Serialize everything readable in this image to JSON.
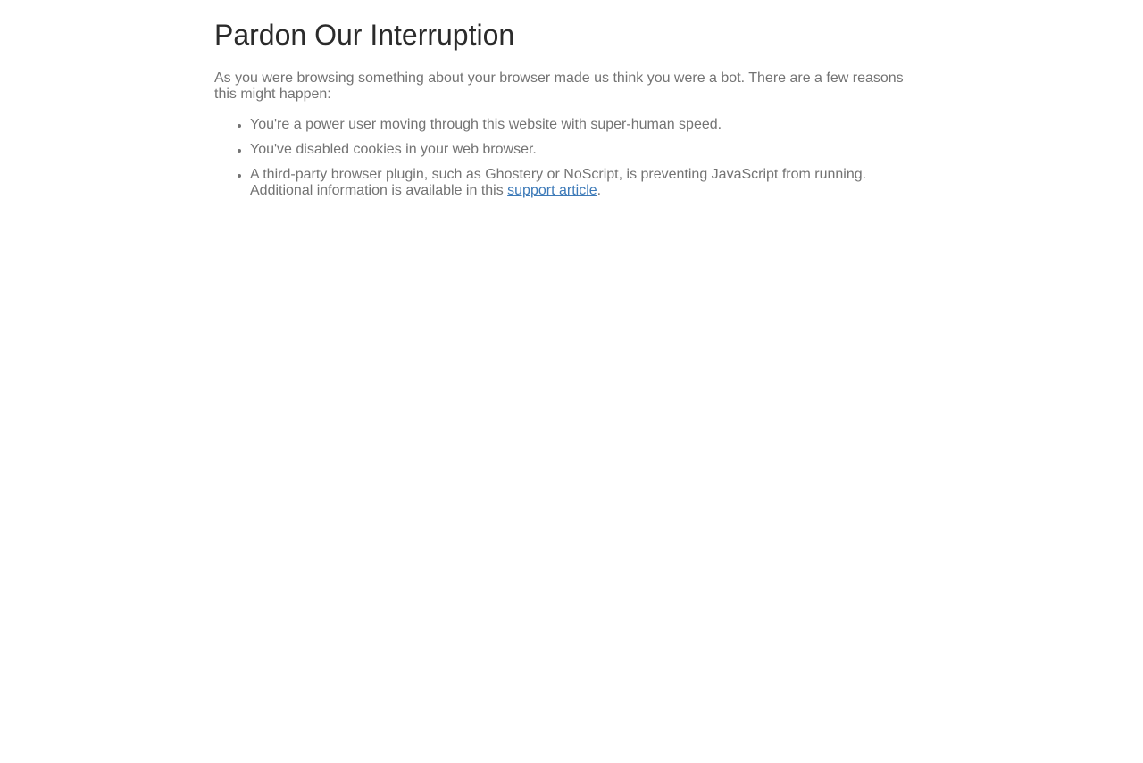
{
  "page": {
    "title": "Pardon Our Interruption",
    "intro": "As you were browsing something about your browser made us think you were a bot. There are a few reasons this might happen:",
    "reasons": [
      {
        "text": "You're a power user moving through this website with super-human speed."
      },
      {
        "text": "You've disabled cookies in your web browser."
      },
      {
        "text": "A third-party browser plugin, such as Ghostery or NoScript, is preventing JavaScript from running. Additional information is available in this ",
        "link_text": "support article",
        "suffix": "."
      }
    ]
  },
  "colors": {
    "title": "#2b2b2b",
    "body_text": "#737373",
    "link": "#3d7ab8",
    "background": "#ffffff"
  }
}
